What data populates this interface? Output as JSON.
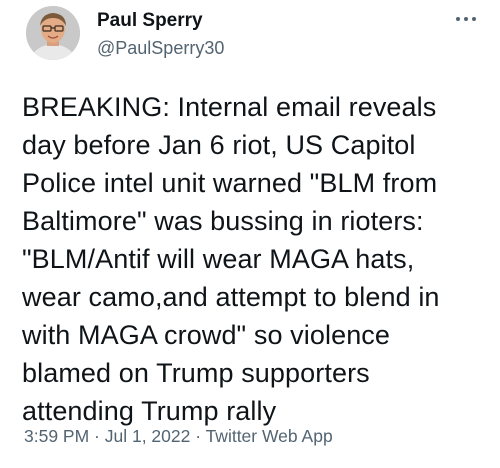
{
  "author": {
    "display_name": "Paul Sperry",
    "handle": "@PaulSperry30"
  },
  "tweet": {
    "text": "BREAKING: Internal email reveals\nday before Jan 6 riot, US Capitol\nPolice intel unit warned \"BLM from\nBaltimore\" was bussing in rioters:\n\"BLM/Antif will wear MAGA hats,\nwear camo,and attempt to blend in\nwith MAGA crowd\" so violence\nblamed on Trump supporters\nattending Trump rally"
  },
  "meta": {
    "timestamp": "3:59 PM · Jul 1, 2022 · Twitter Web App"
  },
  "icons": {
    "avatar": "avatar-photo",
    "more": "more-options-icon"
  },
  "colors": {
    "text": "#0f1419",
    "secondary_text": "#536471",
    "background": "#ffffff"
  }
}
